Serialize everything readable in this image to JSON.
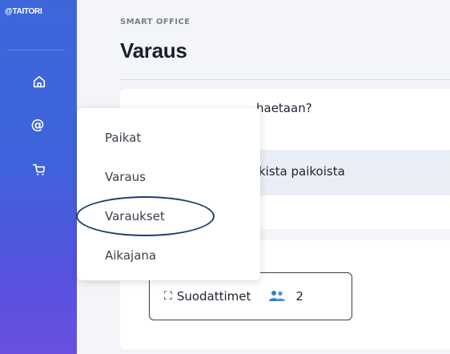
{
  "brand": "@TAITORI",
  "header": {
    "eyebrow": "SMART OFFICE",
    "title": "Varaus"
  },
  "card": {
    "question": "haetaan?",
    "band_text": "kista paikoista"
  },
  "filter": {
    "label": "Suodattimet",
    "count": "2"
  },
  "menu": {
    "items": [
      "Paikat",
      "Varaus",
      "Varaukset",
      "Aikajana"
    ]
  },
  "sidebar": {
    "icons": [
      "home-icon",
      "at-icon",
      "cart-icon"
    ]
  }
}
